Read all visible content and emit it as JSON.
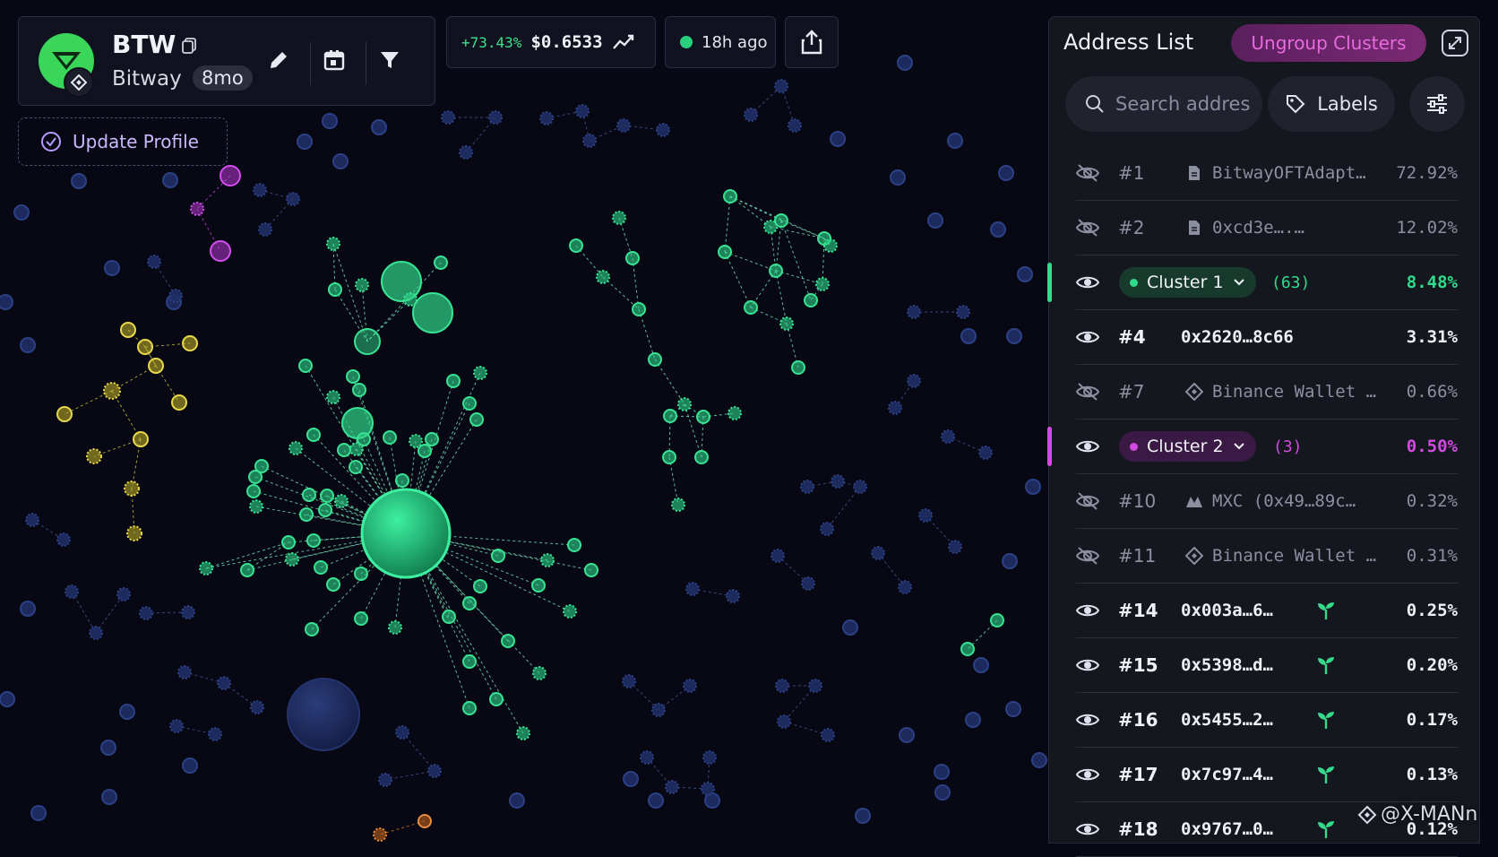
{
  "token": {
    "symbol": "BTW",
    "name": "Bitway",
    "age": "8mo",
    "logo_icon": "bitway-logo-icon",
    "chain_icon": "bnb-chain-icon",
    "update_profile_label": "Update Profile"
  },
  "market": {
    "change": "+73.43%",
    "price": "$0.6533",
    "updated": "18h ago"
  },
  "panel": {
    "title": "Address List",
    "ungroup_label": "Ungroup Clusters",
    "search_placeholder": "Search address",
    "labels_label": "Labels",
    "rows": [
      {
        "type": "address",
        "visible": false,
        "rank": "#1",
        "icon": "contract-icon",
        "address": "BitwayOFTAdapt…",
        "percent": "72.92%"
      },
      {
        "type": "address",
        "visible": false,
        "rank": "#2",
        "icon": "contract-icon",
        "address": "0xcd3e….…",
        "percent": "12.02%"
      },
      {
        "type": "cluster",
        "visible": true,
        "label": "Cluster 1",
        "count": "(63)",
        "percent": "8.48%",
        "color": "#2fdc8c"
      },
      {
        "type": "address",
        "visible": true,
        "rank": "#4",
        "icon": "",
        "address": "0x2620…8c66",
        "percent": "3.31%"
      },
      {
        "type": "address",
        "visible": false,
        "rank": "#7",
        "icon": "binance-icon",
        "address": "Binance Wallet …",
        "percent": "0.66%"
      },
      {
        "type": "cluster",
        "visible": true,
        "label": "Cluster 2",
        "count": "(3)",
        "percent": "0.50%",
        "color": "#d24ae0"
      },
      {
        "type": "address",
        "visible": false,
        "rank": "#10",
        "icon": "mxc-icon",
        "address": "MXC (0x49…89c…",
        "percent": "0.32%"
      },
      {
        "type": "address",
        "visible": false,
        "rank": "#11",
        "icon": "binance-icon",
        "address": "Binance Wallet …",
        "percent": "0.31%"
      },
      {
        "type": "address",
        "visible": true,
        "rank": "#14",
        "icon": "",
        "address": "0x003a…6…",
        "percent": "0.25%",
        "sprout": true
      },
      {
        "type": "address",
        "visible": true,
        "rank": "#15",
        "icon": "",
        "address": "0x5398…d…",
        "percent": "0.20%",
        "sprout": true
      },
      {
        "type": "address",
        "visible": true,
        "rank": "#16",
        "icon": "",
        "address": "0x5455…2…",
        "percent": "0.17%",
        "sprout": true
      },
      {
        "type": "address",
        "visible": true,
        "rank": "#17",
        "icon": "",
        "address": "0x7c97…4…",
        "percent": "0.13%",
        "sprout": true
      },
      {
        "type": "address",
        "visible": true,
        "rank": "#18",
        "icon": "",
        "address": "0x9767…0…",
        "percent": "0.12%",
        "sprout": true
      }
    ]
  },
  "watermark": "@X-MANn",
  "colors": {
    "background": "#070814",
    "cluster_green": "#2fdc8c",
    "cluster_pink": "#d24ae0",
    "cluster_yellow": "#e0d23c",
    "node_blue": "#1f2f66",
    "accent_orange": "#e07a2c"
  }
}
